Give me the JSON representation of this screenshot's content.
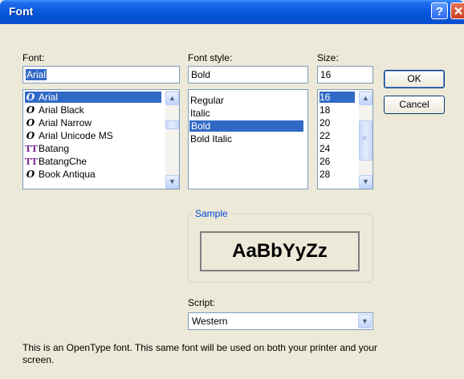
{
  "window": {
    "title": "Font",
    "help_glyph": "?",
    "close_glyph": "✕"
  },
  "font": {
    "label": "Font:",
    "value": "Arial",
    "items": [
      {
        "name": "Arial",
        "icon": "O",
        "selected": true
      },
      {
        "name": "Arial Black",
        "icon": "O"
      },
      {
        "name": "Arial Narrow",
        "icon": "O"
      },
      {
        "name": "Arial Unicode MS",
        "icon": "O"
      },
      {
        "name": "Batang",
        "icon": "TT"
      },
      {
        "name": "BatangChe",
        "icon": "TT"
      },
      {
        "name": "Book Antiqua",
        "icon": "O"
      }
    ]
  },
  "style": {
    "label": "Font style:",
    "value": "Bold",
    "items": [
      "Regular",
      "Italic",
      "Bold",
      "Bold Italic"
    ],
    "selected": "Bold"
  },
  "size": {
    "label": "Size:",
    "value": "16",
    "items": [
      "16",
      "18",
      "20",
      "22",
      "24",
      "26",
      "28"
    ],
    "selected": "16"
  },
  "buttons": {
    "ok": "OK",
    "cancel": "Cancel"
  },
  "sample": {
    "label": "Sample",
    "text": "AaBbYyZz"
  },
  "script": {
    "label": "Script:",
    "value": "Western"
  },
  "description": "This is an OpenType font. This same font will be used on both your printer and your screen.",
  "icons": {
    "up": "▲",
    "down": "▼",
    "grip": "≡",
    "dropdown": "▼"
  },
  "colors": {
    "title_bar": "#0a5adf",
    "selection": "#316ac5",
    "dialog_bg": "#ece9d8",
    "group_label": "#0046d5"
  }
}
